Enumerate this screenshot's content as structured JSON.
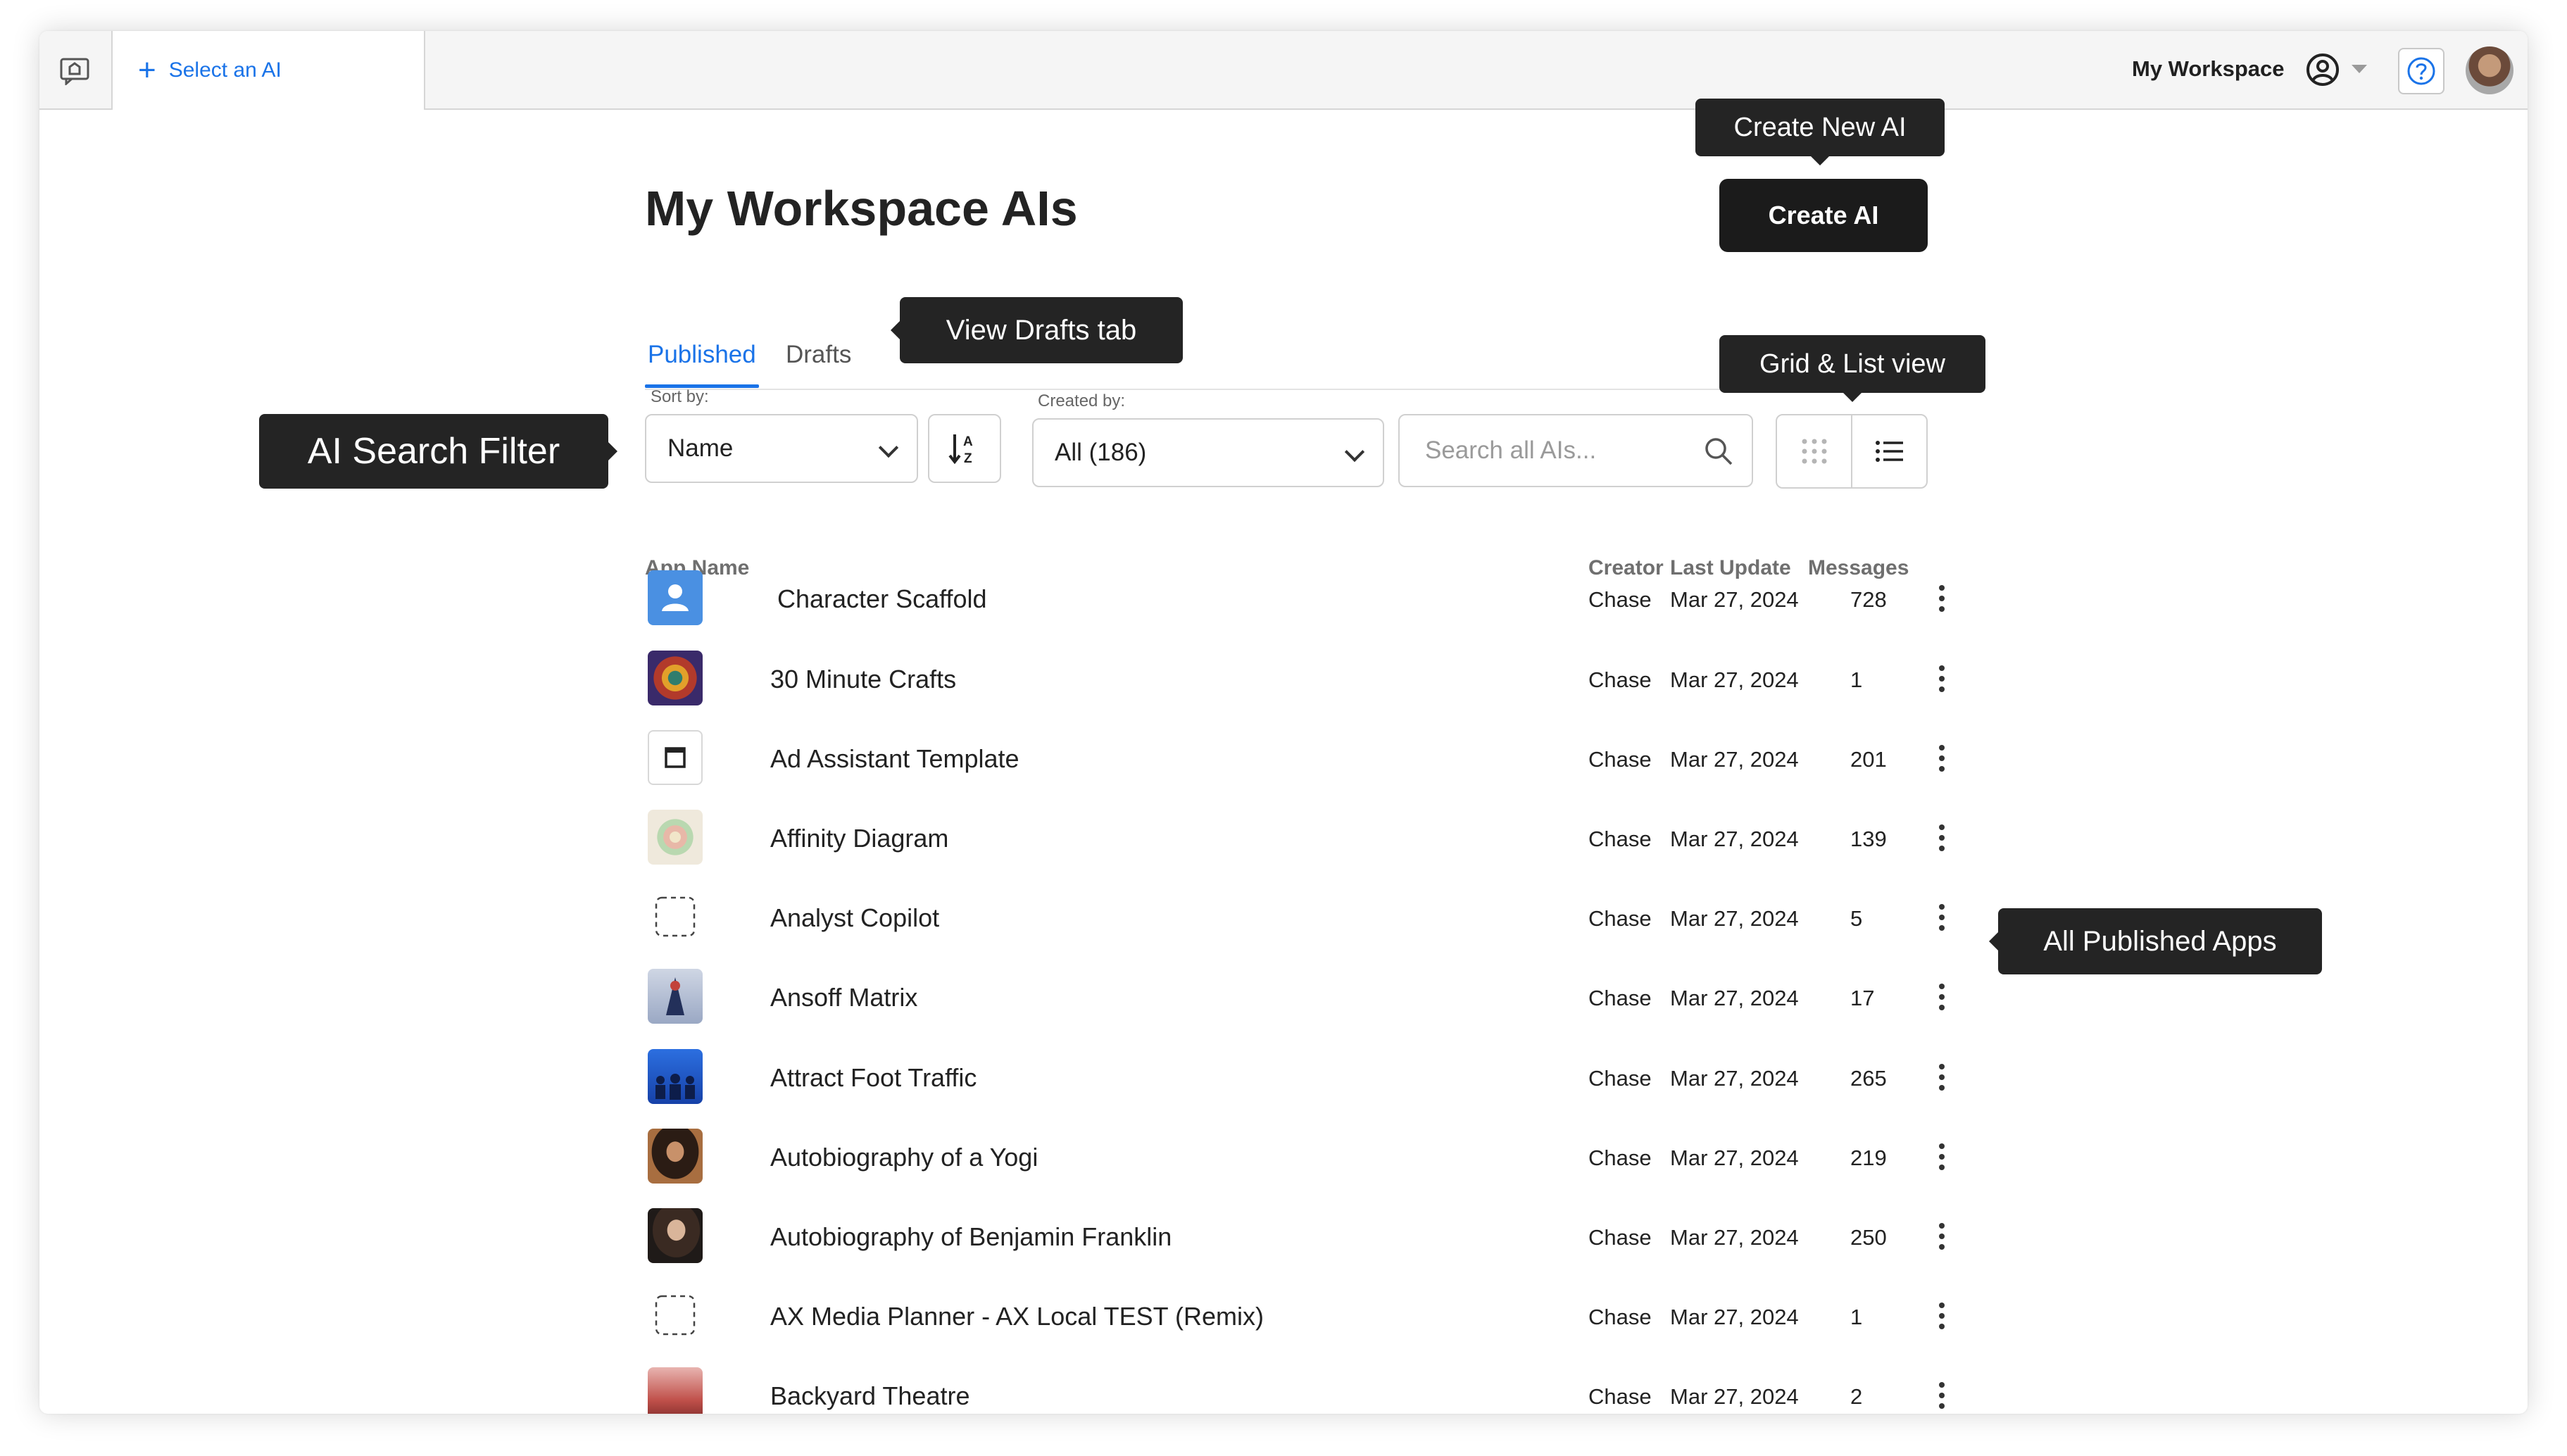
{
  "topbar": {
    "tab_label": "Select an AI",
    "workspace_label": "My Workspace"
  },
  "page": {
    "title": "My Workspace AIs",
    "create_button": "Create AI"
  },
  "tabs": {
    "published": "Published",
    "drafts": "Drafts"
  },
  "filters": {
    "sort_label": "Sort by:",
    "sort_value": "Name",
    "created_label": "Created by:",
    "created_value": "All (186)",
    "search_placeholder": "Search all AIs..."
  },
  "columns": {
    "app_name": "App Name",
    "creator": "Creator",
    "last_update": "Last Update",
    "messages": "Messages"
  },
  "rows": [
    {
      "name": "Character Scaffold",
      "creator": "Chase",
      "date": "Mar 27, 2024",
      "messages": "728"
    },
    {
      "name": "30 Minute Crafts",
      "creator": "Chase",
      "date": "Mar 27, 2024",
      "messages": "1"
    },
    {
      "name": "Ad Assistant Template",
      "creator": "Chase",
      "date": "Mar 27, 2024",
      "messages": "201"
    },
    {
      "name": "Affinity Diagram",
      "creator": "Chase",
      "date": "Mar 27, 2024",
      "messages": "139"
    },
    {
      "name": "Analyst Copilot",
      "creator": "Chase",
      "date": "Mar 27, 2024",
      "messages": "5"
    },
    {
      "name": "Ansoff Matrix",
      "creator": "Chase",
      "date": "Mar 27, 2024",
      "messages": "17"
    },
    {
      "name": "Attract Foot Traffic",
      "creator": "Chase",
      "date": "Mar 27, 2024",
      "messages": "265"
    },
    {
      "name": "Autobiography of a Yogi",
      "creator": "Chase",
      "date": "Mar 27, 2024",
      "messages": "219"
    },
    {
      "name": "Autobiography of Benjamin Franklin",
      "creator": "Chase",
      "date": "Mar 27, 2024",
      "messages": "250"
    },
    {
      "name": "AX Media Planner - AX Local TEST (Remix)",
      "creator": "Chase",
      "date": "Mar 27, 2024",
      "messages": "1"
    },
    {
      "name": "Backyard Theatre",
      "creator": "Chase",
      "date": "Mar 27, 2024",
      "messages": "2"
    }
  ],
  "callouts": {
    "create_new_ai": "Create New AI",
    "view_drafts": "View Drafts tab",
    "grid_list": "Grid & List view",
    "search_filter": "AI Search Filter",
    "all_published": "All Published Apps"
  },
  "colors": {
    "accent": "#1a73e8",
    "button_dark": "#1b1b1b",
    "callout_bg": "#242424"
  }
}
